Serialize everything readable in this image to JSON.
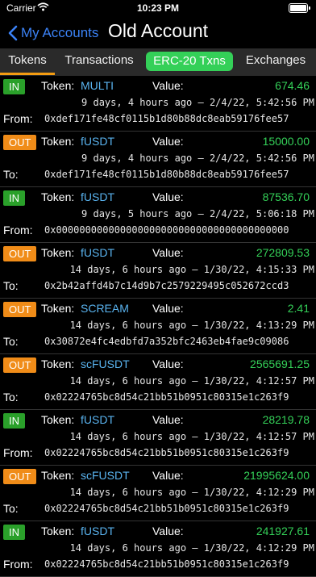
{
  "status": {
    "carrier": "Carrier",
    "time": "10:23 PM"
  },
  "nav": {
    "back_label": "My Accounts",
    "title": "Old Account"
  },
  "tabs": [
    {
      "label": "Tokens"
    },
    {
      "label": "Transactions"
    },
    {
      "label": "ERC-20 Txns"
    },
    {
      "label": "Exchanges"
    }
  ],
  "labels": {
    "token": "Token:",
    "value": "Value:"
  },
  "transactions": [
    {
      "direction": "IN",
      "token": "MULTI",
      "value": "674.46",
      "time": "9 days, 4 hours ago – 2/4/22, 5:42:56 PM",
      "addr_label": "From:",
      "address": "0xdef171fe48cf0115b1d80b88dc8eab59176fee57"
    },
    {
      "direction": "OUT",
      "token": "fUSDT",
      "value": "15000.00",
      "time": "9 days, 4 hours ago – 2/4/22, 5:42:56 PM",
      "addr_label": "To:",
      "address": "0xdef171fe48cf0115b1d80b88dc8eab59176fee57"
    },
    {
      "direction": "IN",
      "token": "fUSDT",
      "value": "87536.70",
      "time": "9 days, 5 hours ago – 2/4/22, 5:06:18 PM",
      "addr_label": "From:",
      "address": "0x0000000000000000000000000000000000000000"
    },
    {
      "direction": "OUT",
      "token": "fUSDT",
      "value": "272809.53",
      "time": "14 days, 6 hours ago – 1/30/22, 4:15:33 PM",
      "addr_label": "To:",
      "address": "0x2b42affd4b7c14d9b7c2579229495c052672ccd3"
    },
    {
      "direction": "OUT",
      "token": "SCREAM",
      "value": "2.41",
      "time": "14 days, 6 hours ago – 1/30/22, 4:13:29 PM",
      "addr_label": "To:",
      "address": "0x30872e4fc4edbfd7a352bfc2463eb4fae9c09086"
    },
    {
      "direction": "OUT",
      "token": "scFUSDT",
      "value": "2565691.25",
      "time": "14 days, 6 hours ago – 1/30/22, 4:12:57 PM",
      "addr_label": "To:",
      "address": "0x02224765bc8d54c21bb51b0951c80315e1c263f9"
    },
    {
      "direction": "IN",
      "token": "fUSDT",
      "value": "28219.78",
      "time": "14 days, 6 hours ago – 1/30/22, 4:12:57 PM",
      "addr_label": "From:",
      "address": "0x02224765bc8d54c21bb51b0951c80315e1c263f9"
    },
    {
      "direction": "OUT",
      "token": "scFUSDT",
      "value": "21995624.00",
      "time": "14 days, 6 hours ago – 1/30/22, 4:12:29 PM",
      "addr_label": "To:",
      "address": "0x02224765bc8d54c21bb51b0951c80315e1c263f9"
    },
    {
      "direction": "IN",
      "token": "fUSDT",
      "value": "241927.61",
      "time": "14 days, 6 hours ago – 1/30/22, 4:12:29 PM",
      "addr_label": "From:",
      "address": "0x02224765bc8d54c21bb51b0951c80315e1c263f9"
    }
  ]
}
